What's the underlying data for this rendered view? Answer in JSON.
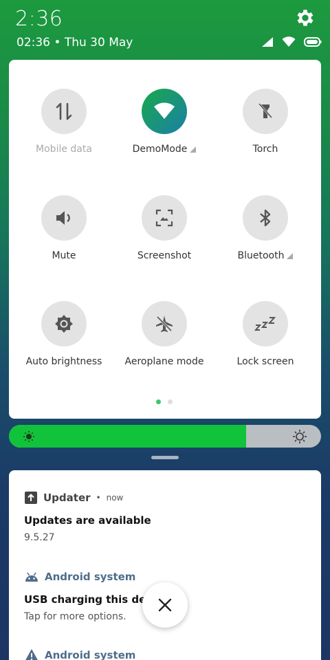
{
  "status": {
    "time_large": "2:36",
    "date_line": "02:36 • Thu 30 May"
  },
  "quick_settings": {
    "tiles": [
      {
        "label": "Mobile data",
        "icon": "mobile-data-icon",
        "state": "off"
      },
      {
        "label": "DemoMode",
        "icon": "wifi-icon",
        "state": "on"
      },
      {
        "label": "Torch",
        "icon": "torch-icon",
        "state": "off"
      },
      {
        "label": "Mute",
        "icon": "volume-icon",
        "state": "off"
      },
      {
        "label": "Screenshot",
        "icon": "screenshot-icon",
        "state": "off"
      },
      {
        "label": "Bluetooth",
        "icon": "bluetooth-icon",
        "state": "off"
      },
      {
        "label": "Auto brightness",
        "icon": "brightness-icon",
        "state": "off"
      },
      {
        "label": "Aeroplane mode",
        "icon": "airplane-icon",
        "state": "off"
      },
      {
        "label": "Lock screen",
        "icon": "sleep-icon",
        "state": "off"
      }
    ],
    "page_count": 2,
    "current_page": 1
  },
  "brightness": {
    "level": 0.76,
    "fill_color": "#11c33a"
  },
  "notifications": [
    {
      "app": "Updater",
      "time": "now",
      "title": "Updates are available",
      "body": "9.5.27",
      "icon": "update-arrow-icon",
      "app_color": "#444444"
    },
    {
      "app": "Android system",
      "title": "USB charging this device",
      "body": "Tap for more options.",
      "icon": "android-icon",
      "app_color": "#4f6d8a"
    },
    {
      "app": "Android system",
      "icon": "warning-icon",
      "app_color": "#4f6d8a"
    }
  ],
  "colors": {
    "accent_green": "#19a84a",
    "tile_bg": "#e3e3e3"
  }
}
